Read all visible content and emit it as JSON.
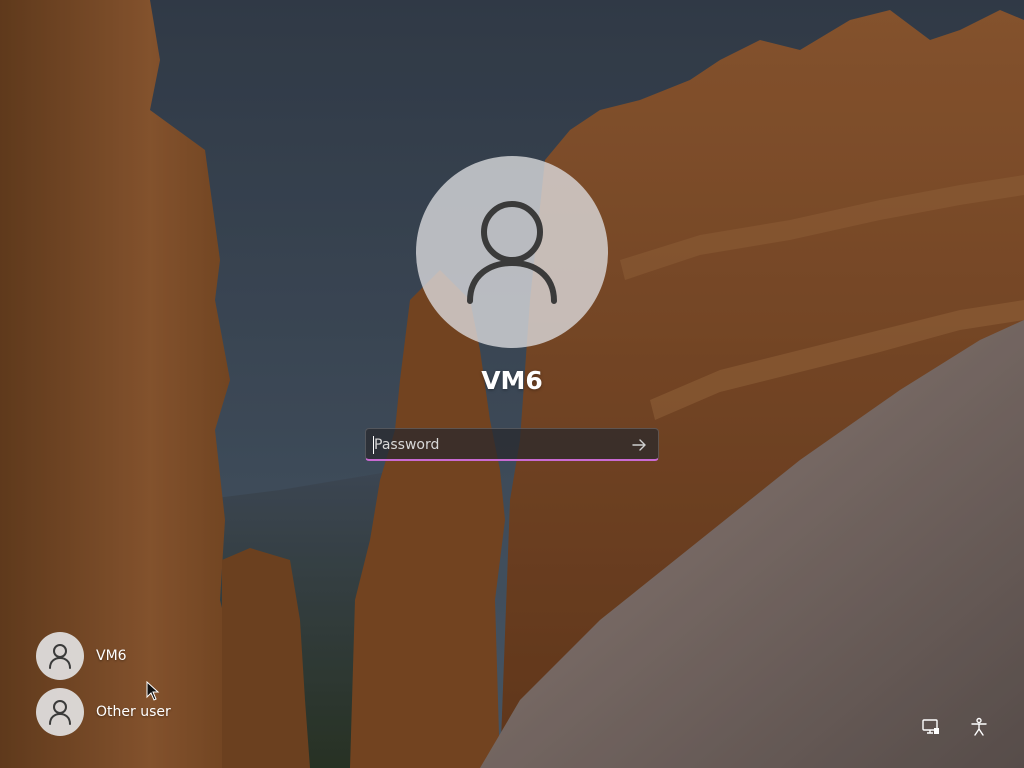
{
  "lock_screen": {
    "account_name": "VM6",
    "password": {
      "placeholder": "Password",
      "value": ""
    },
    "submit_icon": "arrow-right-icon",
    "accent_color": "#c96bd2"
  },
  "user_list": [
    {
      "label": "VM6",
      "icon": "user-icon"
    },
    {
      "label": "Other user",
      "icon": "user-icon"
    }
  ],
  "corner_icons": [
    {
      "icon": "network-icon"
    },
    {
      "icon": "accessibility-icon"
    }
  ]
}
